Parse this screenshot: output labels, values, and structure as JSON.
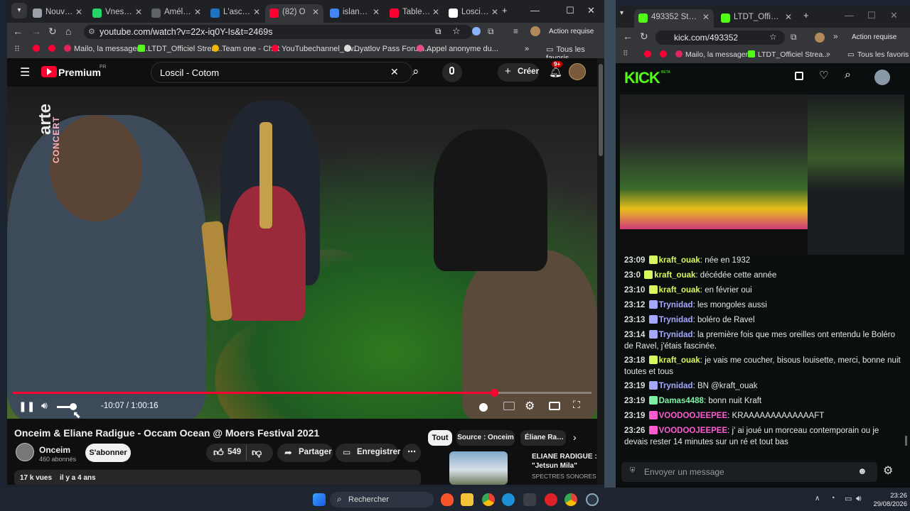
{
  "left_browser": {
    "tabs": [
      {
        "label": "Nouveau",
        "color": "#9aa0a6"
      },
      {
        "label": "Vnesa - C",
        "color": "#25d366"
      },
      {
        "label": "Améliorer",
        "color": "#5f6368"
      },
      {
        "label": "L'ascensio",
        "color": "#1e73be"
      },
      {
        "label": "(82) O",
        "color": "#ff0033",
        "active": true
      },
      {
        "label": "islande 19",
        "color": "#4285f4"
      },
      {
        "label": "Tableau d",
        "color": "#ff0033"
      },
      {
        "label": "Loscil - W",
        "color": "#ffffff"
      }
    ],
    "url": "youtube.com/watch?v=22x-iq0Y-Is&t=2469s",
    "action_required": "Action requise",
    "bookmarks": [
      "Mailo, la messageri...",
      "LTDT_Officiel Strea...",
      "Team one - Chat",
      "YouTubechannel_sw...",
      "Dyatlov Pass Forum...",
      "Appel anonyme du..."
    ],
    "all_favorites": "Tous les favoris"
  },
  "youtube": {
    "logo": "Premium",
    "logo_sup": "FR",
    "search_value": "Loscil - Cotom",
    "create_label": "Créer",
    "notif_count": "9+",
    "time_current": "-10:07",
    "time_total": "1:00:16",
    "time_sep": " / ",
    "progress": 0.832,
    "channel_watermark_1": "arte",
    "channel_watermark_2": "CONCERT",
    "video_title": "Onceim & Eliane Radigue - Occam Ocean @ Moers Festival 2021",
    "channel_name": "Onceim",
    "subscribers": "460 abonnés",
    "subscribe_label": "S'abonner",
    "likes": "549",
    "share_label": "Partager",
    "save_label": "Enregistrer",
    "views": "17 k vues",
    "age": "il y a 4 ans",
    "chips": [
      "Tout",
      "Source : Onceim",
      "Éliane Radig"
    ],
    "suggestion_title_1": "ELIANE RADIGUE :",
    "suggestion_title_2": "\"Jetsun Mila\"",
    "suggestion_channel": "SPECTRES SONORES"
  },
  "right_browser": {
    "tabs": [
      {
        "label": "493352 Stream - W",
        "color": "#53fc18",
        "active": true
      },
      {
        "label": "LTDT_Officiel Strea",
        "color": "#53fc18"
      }
    ],
    "url": "kick.com/493352",
    "action_required": "Action requise",
    "bookmarks": [
      "Mailo, la messageri...",
      "LTDT_Officiel Strea..."
    ],
    "all_favorites": "Tous les favoris",
    "logo": "KICK",
    "logo_sup": "BETA"
  },
  "chat": {
    "messages": [
      {
        "time": "23:09",
        "user": "kraft_ouak",
        "color": "#d7f85e",
        "text": "née en 1932"
      },
      {
        "time": "23:0",
        "user": "kraft_ouak",
        "color": "#d7f85e",
        "text": "décédée cette année"
      },
      {
        "time": "23:10",
        "user": "kraft_ouak",
        "color": "#d7f85e",
        "text": "en février oui"
      },
      {
        "time": "23:12",
        "user": "Trynidad",
        "color": "#a5a8ff",
        "text": "les mongoles aussi"
      },
      {
        "time": "23:13",
        "user": "Trynidad",
        "color": "#a5a8ff",
        "text": "boléro de Ravel"
      },
      {
        "time": "23:14",
        "user": "Trynidad",
        "color": "#a5a8ff",
        "text": "la première fois que mes oreilles ont entendu le Boléro de Ravel, j'étais fascinée."
      },
      {
        "time": "23:18",
        "user": "kraft_ouak",
        "color": "#d7f85e",
        "text": "je vais me coucher, bisous louisette, merci, bonne nuit toutes et tous"
      },
      {
        "time": "23:19",
        "user": "Trynidad",
        "color": "#a5a8ff",
        "text": "BN @kraft_ouak"
      },
      {
        "time": "23:19",
        "user": "Damas4488",
        "color": "#7ef0a4",
        "text": "bonn nuit Kraft"
      },
      {
        "time": "23:19",
        "user": "VOODOOJEEPEE",
        "color": "#ff5bd0",
        "text": "KRAAAAAAAAAAAAAFT"
      },
      {
        "time": "23:26",
        "user": "VOODOOJEEPEE",
        "color": "#ff5bd0",
        "text": "j' ai joué un morceau contemporain ou je devais rester 14 minutes sur un ré et tout bas"
      }
    ],
    "input_placeholder": "Envoyer un message"
  },
  "taskbar": {
    "search_label": "Rechercher",
    "time": "23:26",
    "date": "29/08/2026"
  }
}
